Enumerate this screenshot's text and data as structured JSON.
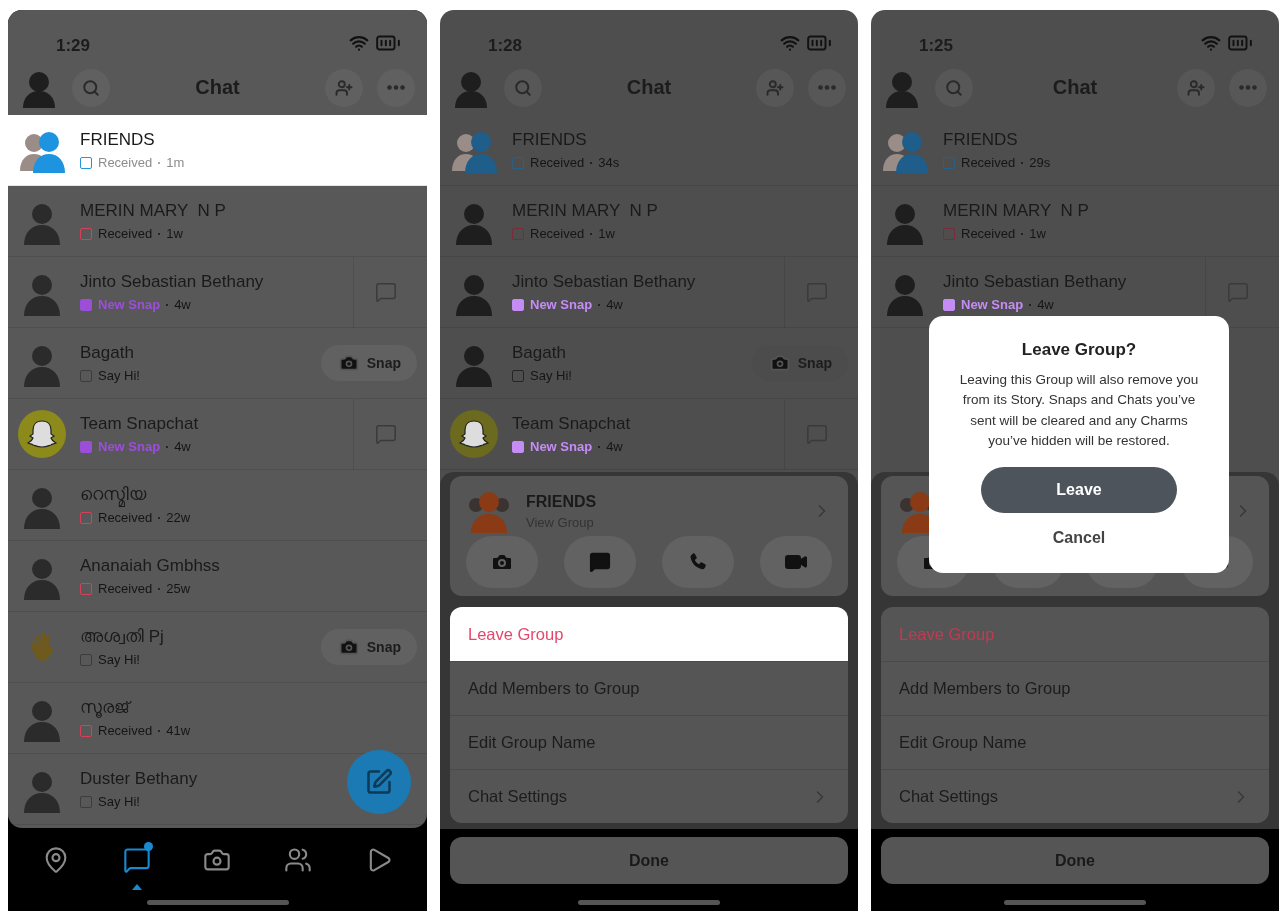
{
  "panels": [
    {
      "time": "1:29",
      "title": "Chat",
      "chats": [
        {
          "name": "FRIENDS",
          "kind": "group",
          "status": "Received",
          "time": "1m",
          "color": "#2196d9",
          "filled": false,
          "selected": true
        },
        {
          "name": "MERIN MARY  N P",
          "kind": "person",
          "status": "Received",
          "time": "1w",
          "color": "#d8405a",
          "filled": false,
          "selected": false
        },
        {
          "name": "Jinto Sebastian Bethany",
          "kind": "person",
          "status": "New Snap",
          "time": "4w",
          "color": "#9b4fd8",
          "filled": true,
          "selected": false,
          "action": {
            "kind": "chat"
          }
        },
        {
          "name": "Bagath",
          "kind": "person",
          "status": "Say Hi!",
          "color": "#3c3c3c",
          "filled": false,
          "selected": false,
          "action": {
            "kind": "snap",
            "label": "Snap"
          }
        },
        {
          "name": "Team Snapchat",
          "kind": "ghost",
          "status": "New Snap",
          "time": "4w",
          "color": "#9b4fd8",
          "filled": true,
          "selected": false,
          "action": {
            "kind": "chat"
          }
        },
        {
          "name": "റെസ്മിയ",
          "kind": "person",
          "status": "Received",
          "time": "22w",
          "color": "#d8405a",
          "filled": false,
          "selected": false
        },
        {
          "name": "Ananaiah Gmbhss",
          "kind": "person",
          "status": "Received",
          "time": "25w",
          "color": "#d8405a",
          "filled": false,
          "selected": false
        },
        {
          "name": "അശ്വതി Pj",
          "kind": "wave",
          "status": "Say Hi!",
          "color": "#3c3c3c",
          "filled": false,
          "selected": false,
          "action": {
            "kind": "snap",
            "label": "Snap"
          }
        },
        {
          "name": "സൂരജ്",
          "kind": "person",
          "status": "Received",
          "time": "41w",
          "color": "#d8405a",
          "filled": false,
          "selected": false
        },
        {
          "name": "Duster Bethany",
          "kind": "person",
          "status": "Say Hi!",
          "color": "#3c3c3c",
          "filled": false,
          "selected": false
        }
      ],
      "nav": [
        {
          "selected": false,
          "unread": false
        },
        {
          "selected": true,
          "unread": true
        },
        {
          "selected": false,
          "unread": false
        },
        {
          "selected": false,
          "unread": false
        },
        {
          "selected": false,
          "unread": false
        }
      ]
    },
    {
      "time": "1:28",
      "title": "Chat",
      "chats": [
        {
          "name": "FRIENDS",
          "kind": "group",
          "status": "Received",
          "time": "34s",
          "color": "#2a5f86",
          "filled": false,
          "selected": false
        },
        {
          "name": "MERIN MARY  N P",
          "kind": "person",
          "status": "Received",
          "time": "1w",
          "color": "#7a2a38",
          "filled": false,
          "selected": false
        },
        {
          "name": "Jinto Sebastian Bethany",
          "kind": "person",
          "status": "New Snap",
          "time": "4w",
          "color": "#c58cf5",
          "filled": true,
          "selected": false,
          "action": {
            "kind": "chat"
          }
        },
        {
          "name": "Bagath",
          "kind": "person",
          "status": "Say Hi!",
          "color": "#262626",
          "filled": false,
          "selected": false,
          "action": {
            "kind": "snap",
            "label": "Snap"
          }
        },
        {
          "name": "Team Snapchat",
          "kind": "ghost",
          "status": "New Snap",
          "time": "4w",
          "color": "#c58cf5",
          "filled": true,
          "selected": false,
          "action": {
            "kind": "chat"
          }
        }
      ],
      "sheet": {
        "group_name": "FRIENDS",
        "subtitle": "View Group",
        "menu": [
          {
            "label": "Leave Group",
            "kind": "destructive",
            "selected": true
          },
          {
            "label": "Add Members to Group",
            "kind": "plain",
            "selected": false
          },
          {
            "label": "Edit Group Name",
            "kind": "plain",
            "selected": false
          },
          {
            "label": "Chat Settings",
            "kind": "link",
            "selected": false
          }
        ],
        "done": "Done"
      }
    },
    {
      "time": "1:25",
      "title": "Chat",
      "chats": [
        {
          "name": "FRIENDS",
          "kind": "group",
          "status": "Received",
          "time": "29s",
          "color": "#2a5f86",
          "filled": false,
          "selected": false
        },
        {
          "name": "MERIN MARY  N P",
          "kind": "person",
          "status": "Received",
          "time": "1w",
          "color": "#7a2a38",
          "filled": false,
          "selected": false
        },
        {
          "name": "Jinto Sebastian Bethany",
          "kind": "person",
          "status": "New Snap",
          "time": "4w",
          "color": "#c58cf5",
          "filled": true,
          "selected": false,
          "action": {
            "kind": "chat"
          }
        }
      ],
      "sheet": {
        "menu": [
          {
            "label": "Leave Group",
            "kind": "destructive",
            "selected": false
          },
          {
            "label": "Add Members to Group",
            "kind": "plain",
            "selected": false
          },
          {
            "label": "Edit Group Name",
            "kind": "plain",
            "selected": false
          },
          {
            "label": "Chat Settings",
            "kind": "link",
            "selected": false
          }
        ],
        "done": "Done"
      },
      "dialog": {
        "title": "Leave Group?",
        "message": "Leaving this Group will also remove you from its Story. Snaps and Chats you’ve sent will be cleared and any Charms you’ve hidden will be restored.",
        "confirm": "Leave",
        "cancel": "Cancel"
      }
    }
  ]
}
